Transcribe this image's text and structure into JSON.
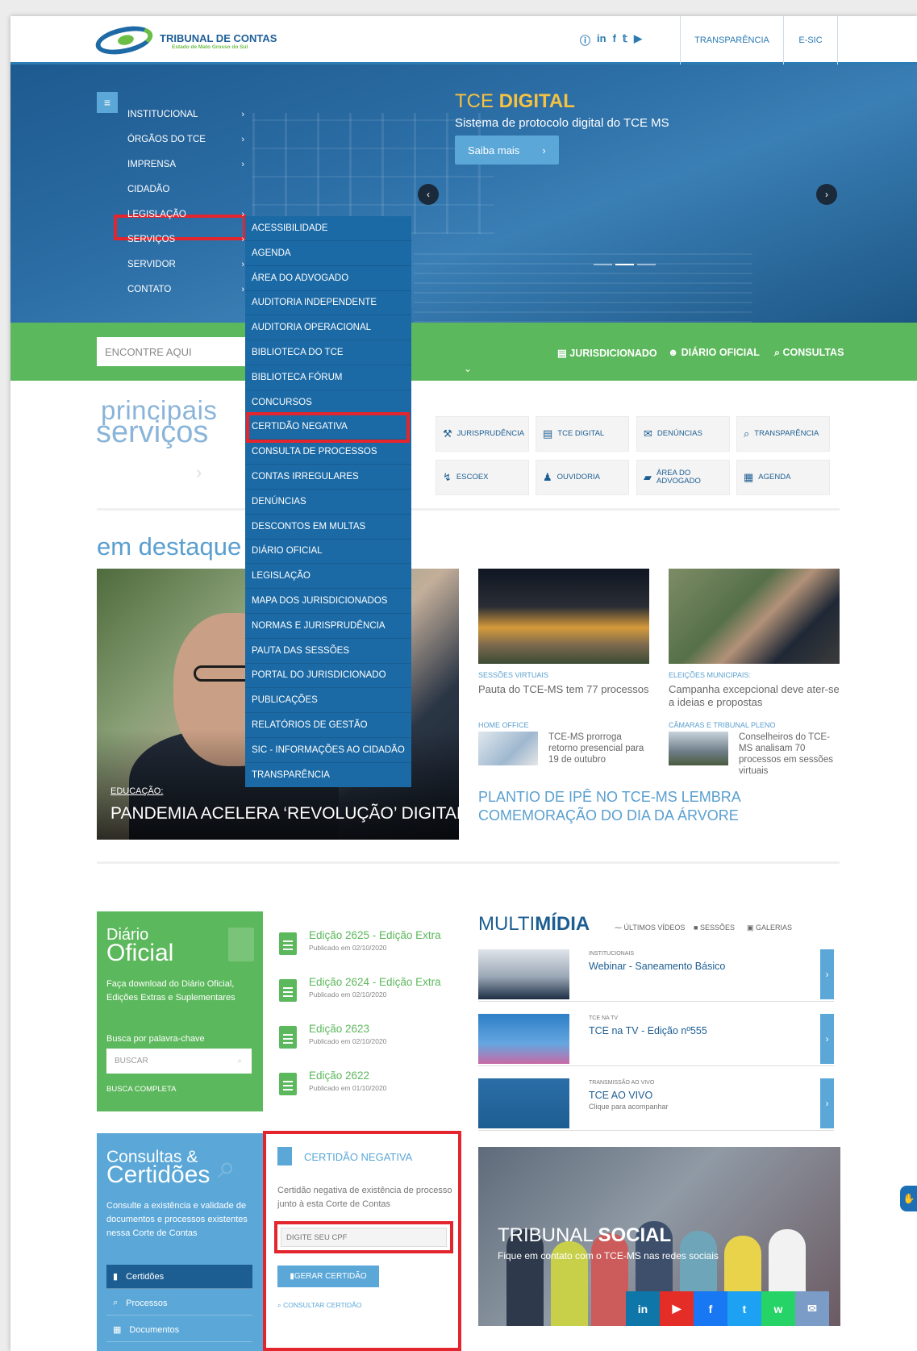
{
  "header": {
    "logo_main": "TRIBUNAL DE CONTAS",
    "logo_sub": "Estado de Mato Grosso do Sul",
    "social_icons": [
      "info-icon",
      "linkedin-icon",
      "facebook-icon",
      "twitter-icon",
      "youtube-icon"
    ],
    "links": [
      "TRANSPARÊNCIA",
      "E-SIC"
    ]
  },
  "hero": {
    "title_light": "TCE ",
    "title_bold": "DIGITAL",
    "subtitle": "Sistema de protocolo digital do TCE MS",
    "button": "Saiba mais"
  },
  "menu": {
    "items": [
      "INSTITUCIONAL",
      "ÓRGÃOS DO TCE",
      "IMPRENSA",
      "CIDADÃO",
      "LEGISLAÇÃO",
      "SERVIÇOS",
      "SERVIDOR",
      "CONTATO"
    ]
  },
  "submenu": {
    "items": [
      "ACESSIBILIDADE",
      "AGENDA",
      "ÁREA DO ADVOGADO",
      "AUDITORIA INDEPENDENTE",
      "AUDITORIA OPERACIONAL",
      "BIBLIOTECA DO TCE",
      "BIBLIOTECA FÓRUM",
      "CONCURSOS",
      "CERTIDÃO NEGATIVA",
      "CONSULTA DE PROCESSOS",
      "CONTAS IRREGULARES",
      "DENÚNCIAS",
      "DESCONTOS EM MULTAS",
      "DIÁRIO OFICIAL",
      "LEGISLAÇÃO",
      "MAPA DOS JURISDICIONADOS",
      "NORMAS E JURISPRUDÊNCIA",
      "PAUTA DAS SESSÕES",
      "PORTAL DO JURISDICIONADO",
      "PUBLICAÇÕES",
      "RELATÓRIOS DE GESTÃO",
      "SIC - INFORMAÇÕES AO CIDADÃO",
      "TRANSPARÊNCIA"
    ]
  },
  "greenbar": {
    "search_placeholder": "ENCONTRE AQUI",
    "links": [
      "JURISDICIONADO",
      "DIÁRIO OFICIAL",
      "CONSULTAS"
    ]
  },
  "servicos": {
    "title1": "principais",
    "title2": "serviços",
    "items": [
      "JURISPRUDÊNCIA",
      "TCE DIGITAL",
      "DENÚNCIAS",
      "TRANSPARÊNCIA",
      "ESCOEX",
      "OUVIDORIA",
      "ÁREA DO ADVOGADO",
      "AGENDA"
    ]
  },
  "destaque": {
    "title": "em destaque",
    "main": {
      "category": "EDUCAÇÃO:",
      "title": "PANDEMIA ACELERA ‘REVOLUÇÃO’ DIGITAL"
    },
    "news": [
      {
        "category": "SESSÕES VIRTUAIS",
        "title": "Pauta do TCE-MS tem 77 processos"
      },
      {
        "category": "ELEIÇÕES MUNICIPAIS:",
        "title": "Campanha excepcional deve ater-se a ideias e propostas"
      },
      {
        "category": "HOME OFFICE",
        "title": "TCE-MS prorroga retorno presencial para 19 de outubro"
      },
      {
        "category": "CÂMARAS E TRIBUNAL PLENO",
        "title": "Conselheiros do TCE-MS analisam 70 processos em sessões virtuais"
      }
    ],
    "plantio": "PLANTIO DE IPÊ NO TCE-MS LEMBRA COMEMORAÇÃO DO DIA DA ÁRVORE"
  },
  "diario": {
    "title1": "Diário",
    "title2": "Oficial",
    "desc": "Faça download do Diário Oficial, Edições Extras e Suplementares",
    "busca_label": "Busca por palavra-chave",
    "busca_placeholder": "BUSCAR",
    "busca_completa": "BUSCA COMPLETA",
    "edicoes": [
      {
        "title": "Edição 2625 - Edição Extra",
        "date": "Publicado em 02/10/2020"
      },
      {
        "title": "Edição 2624 - Edição Extra",
        "date": "Publicado em 02/10/2020"
      },
      {
        "title": "Edição 2623",
        "date": "Publicado em 02/10/2020"
      },
      {
        "title": "Edição 2622",
        "date": "Publicado em 01/10/2020"
      }
    ]
  },
  "multimidia": {
    "title_light": "MULTI",
    "title_bold": "MÍDIA",
    "tabs": [
      "ÚLTIMOS VÍDEOS",
      "SESSÕES",
      "GALERIAS"
    ],
    "videos": [
      {
        "category": "INSTITUCIONAIS",
        "title": "Webinar - Saneamento Básico",
        "sub": ""
      },
      {
        "category": "TCE NA TV",
        "title": "TCE na TV - Edição nº555",
        "sub": ""
      },
      {
        "category": "TRANSMISSÃO AO VIVO",
        "title": "TCE AO VIVO",
        "sub": "Clique para acompanhar"
      }
    ]
  },
  "social": {
    "title_light": "TRIBUNAL ",
    "title_bold": "SOCIAL",
    "subtitle": "Fique em contato com o TCE-MS nas redes sociais",
    "buttons": [
      "in",
      "▶",
      "f",
      "t",
      "w",
      "✉"
    ],
    "colors": [
      "#0e76a8",
      "#e52d27",
      "#1877f2",
      "#1da1f2",
      "#25d366",
      "#7a9cc6"
    ]
  },
  "consultas": {
    "title1": "Consultas &",
    "title2": "Certidões",
    "desc": "Consulte a existência e validade de documentos e processos existentes nessa Corte de Contas",
    "links": [
      "Certidões",
      "Processos",
      "Documentos"
    ]
  },
  "certidao": {
    "title": "CERTIDÃO NEGATIVA",
    "desc": "Certidão negativa de existência de processo junto à esta Corte de Contas",
    "cpf_placeholder": "DIGITE SEU CPF",
    "button": "GERAR CERTIDÃO",
    "consultar": "CONSULTAR CERTIDÃO"
  }
}
